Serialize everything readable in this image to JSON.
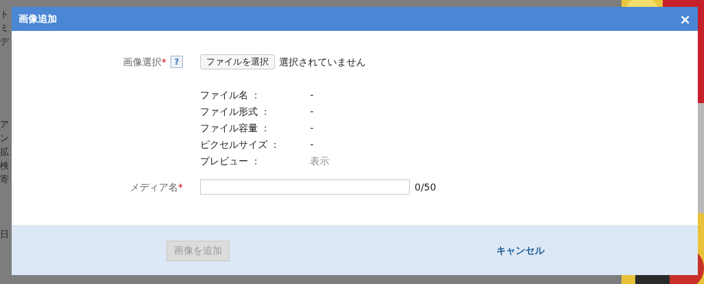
{
  "background": {
    "fragments": [
      "ト",
      "ミ",
      "デ",
      "ア",
      "ン",
      "拡",
      "検",
      "寄",
      "日"
    ]
  },
  "dialog": {
    "title": "画像追加",
    "close": "×",
    "image_field": {
      "label": "画像選択",
      "required": "*",
      "help": "?",
      "button": "ファイルを選択",
      "status": "選択されていません"
    },
    "info": [
      {
        "label": "ファイル名 ：",
        "value": "-",
        "kind": "text"
      },
      {
        "label": "ファイル形式 ：",
        "value": "-",
        "kind": "text"
      },
      {
        "label": "ファイル容量 ：",
        "value": "-",
        "kind": "text"
      },
      {
        "label": "ピクセルサイズ ：",
        "value": "-",
        "kind": "text"
      },
      {
        "label": "プレビュー ：",
        "value": "表示",
        "kind": "link"
      }
    ],
    "media_name": {
      "label": "メディア名",
      "required": "*",
      "counter": "0/50"
    },
    "footer": {
      "submit": {
        "label": "画像を追加",
        "disabled": true
      },
      "cancel": "キャンセル"
    }
  }
}
